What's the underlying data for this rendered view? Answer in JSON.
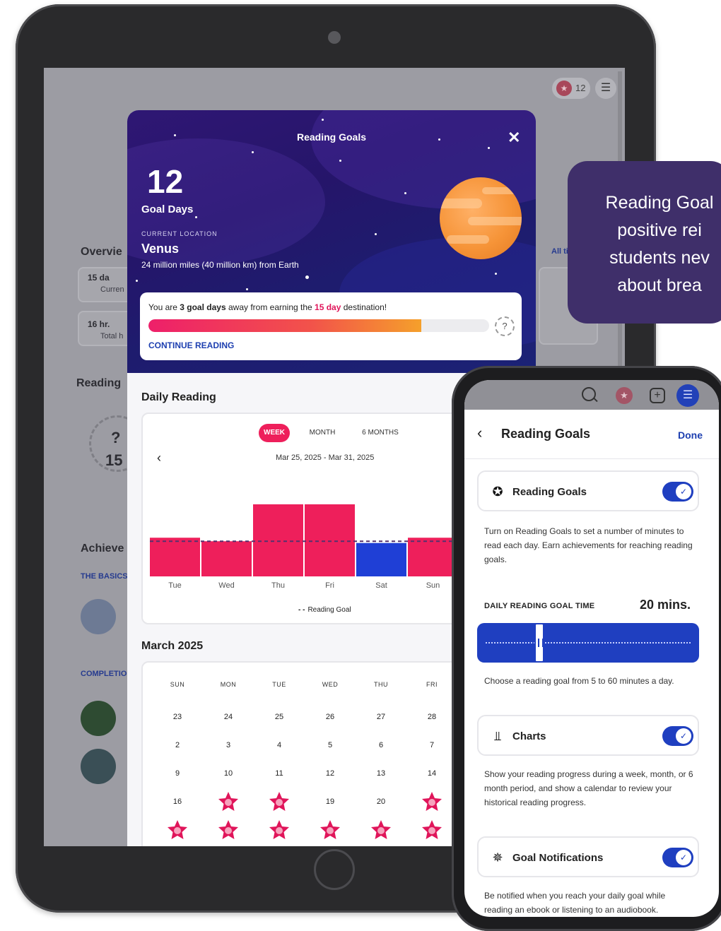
{
  "background_app": {
    "coin_count": "12",
    "overview_label": "Overvie",
    "streak_value": "15 da",
    "streak_caption": "Curren",
    "total_value": "16 hr.",
    "total_caption": "Total h",
    "all_time_link": "All time",
    "reading_label": "Reading",
    "badge_help": "?",
    "badge_number": "15",
    "achievements_label": "Achieve",
    "basics_label": "THE BASICS",
    "completion_label": "COMPLETIO"
  },
  "modal": {
    "title": "Reading Goals",
    "close_glyph": "✕",
    "goal_days_number": "12",
    "goal_days_label": "Goal Days",
    "current_location_label": "CURRENT LOCATION",
    "location_name": "Venus",
    "location_distance": "24 million miles (40 million km) from Earth",
    "progress": {
      "text_before": "You are ",
      "days_away": "3 goal days",
      "text_middle": " away from earning the ",
      "destination": "15 day",
      "text_after": " destination!",
      "fill_fraction": 0.8,
      "help_glyph": "?",
      "continue_label": "CONTINUE READING"
    },
    "daily_reading_title": "Daily Reading",
    "tabs": [
      "WEEK",
      "MONTH",
      "6 MONTHS"
    ],
    "active_tab": 0,
    "prev_glyph": "‹",
    "date_range": "Mar 25, 2025 - Mar 31, 2025",
    "legend_label": "Reading Goal",
    "march_title": "March 2025",
    "calendar": {
      "headers": [
        "SUN",
        "MON",
        "TUE",
        "WED",
        "THU",
        "FRI"
      ],
      "rows": [
        [
          "23",
          "24",
          "25",
          "26",
          "27",
          "28"
        ],
        [
          "2",
          "3",
          "4",
          "5",
          "6",
          "7"
        ],
        [
          "9",
          "10",
          "11",
          "12",
          "13",
          "14"
        ],
        [
          "16",
          "*",
          "*",
          "19",
          "20",
          "*"
        ],
        [
          "*",
          "*",
          "*",
          "*",
          "*",
          "*"
        ]
      ]
    }
  },
  "chart_data": {
    "type": "bar",
    "categories": [
      "Tue",
      "Wed",
      "Thu",
      "Fri",
      "Sat",
      "Sun"
    ],
    "values": [
      22,
      20,
      41,
      41,
      19,
      22
    ],
    "goal": 20,
    "ylim": [
      0,
      45
    ],
    "colors": [
      "#ee1f5b",
      "#ee1f5b",
      "#ee1f5b",
      "#ee1f5b",
      "#1f3fd6",
      "#ee1f5b"
    ],
    "goal_line_color": "#55306e"
  },
  "phone": {
    "back_glyph": "‹",
    "title": "Reading Goals",
    "done_label": "Done",
    "reading_goals_toggle_label": "Reading Goals",
    "reading_goals_desc": "Turn on Reading Goals to set a number of minutes to read each day. Earn achievements for reaching reading goals.",
    "goal_time_label": "DAILY READING GOAL TIME",
    "goal_time_value": "20 mins.",
    "slider_fraction": 0.27,
    "slider_help": "Choose a reading goal from 5 to 60 minutes a day.",
    "charts_toggle_label": "Charts",
    "charts_desc": "Show your reading progress during a week, month, or 6 month period, and show a calendar to review your historical reading progress.",
    "notifications_toggle_label": "Goal Notifications",
    "notifications_desc": "Be notified when you reach your daily goal while reading an ebook or listening to an audiobook.",
    "toggle_glyph": "✓"
  },
  "callout": {
    "text": "Reading Goal\npositive rei\nstudents nev\nabout brea"
  },
  "colors": {
    "accent_pink": "#ee1f5b",
    "accent_blue": "#1f3fc0",
    "callout_bg": "#3f2f6a"
  },
  "icons": {
    "star_badge": "star-badge-icon",
    "charts": "chart-icon",
    "notifications": "notification-star-icon"
  }
}
